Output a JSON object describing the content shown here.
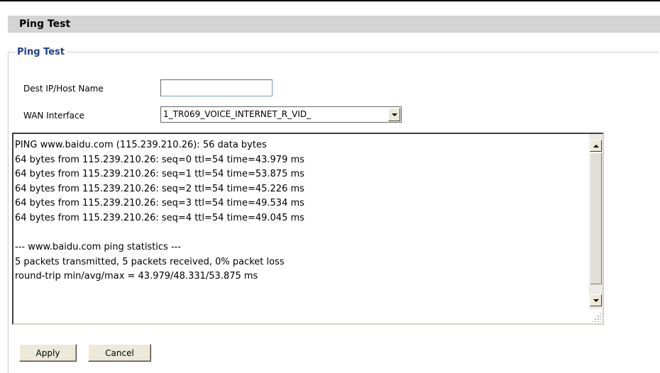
{
  "header": {
    "title": "Ping Test"
  },
  "group": {
    "legend": "Ping Test"
  },
  "form": {
    "dest_label": "Dest IP/Host Name",
    "dest_value": "",
    "wan_label": "WAN Interface",
    "wan_selected": "1_TR069_VOICE_INTERNET_R_VID_"
  },
  "output": {
    "lines": [
      "PING www.baidu.com (115.239.210.26): 56 data bytes",
      "64 bytes from 115.239.210.26: seq=0 ttl=54 time=43.979 ms",
      "64 bytes from 115.239.210.26: seq=1 ttl=54 time=53.875 ms",
      "64 bytes from 115.239.210.26: seq=2 ttl=54 time=45.226 ms",
      "64 bytes from 115.239.210.26: seq=3 ttl=54 time=49.534 ms",
      "64 bytes from 115.239.210.26: seq=4 ttl=54 time=49.045 ms",
      "",
      "--- www.baidu.com ping statistics ---",
      "5 packets transmitted, 5 packets received, 0% packet loss",
      "round-trip min/avg/max = 43.979/48.331/53.875 ms"
    ]
  },
  "buttons": {
    "apply": "Apply",
    "cancel": "Cancel"
  },
  "icons": {
    "select_arrow": "chevron-down-icon",
    "scroll_up": "scroll-up-arrow-icon",
    "scroll_down": "scroll-down-arrow-icon",
    "resize_grip": "resize-grip-icon"
  },
  "colors": {
    "title_bar_bg": "#d4d4d4",
    "legend_text": "#1c3f8c"
  }
}
